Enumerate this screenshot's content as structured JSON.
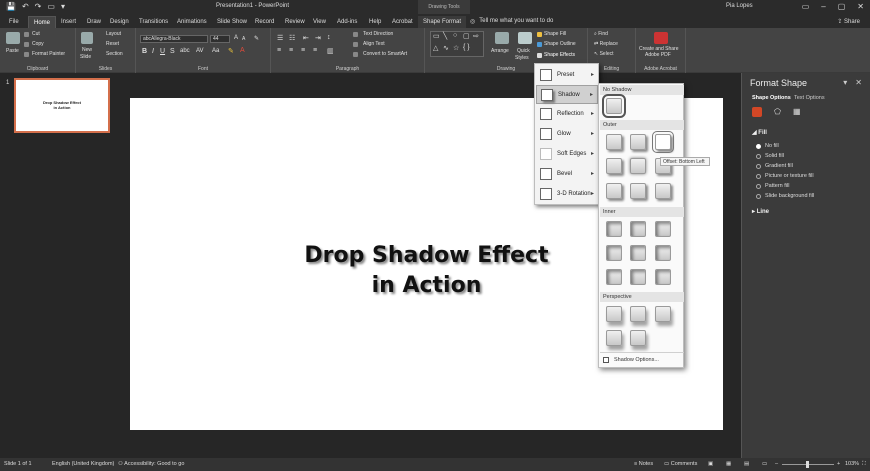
{
  "titlebar": {
    "doc_title": "Presentation1 - PowerPoint",
    "tools_tab": "Drawing Tools",
    "user": "Pia Lopes",
    "qat": [
      "💾",
      "↶",
      "↷",
      "▭",
      "▾"
    ],
    "win_ctrls": [
      "▭",
      "–",
      "▢",
      "✕"
    ]
  },
  "tabs": [
    "File",
    "Home",
    "Insert",
    "Draw",
    "Design",
    "Transitions",
    "Animations",
    "Slide Show",
    "Record",
    "Review",
    "View",
    "Add-ins",
    "Help",
    "Acrobat",
    "Shape Format"
  ],
  "tell_me": "Tell me what you want to do",
  "share_label": "Share",
  "ribbon": {
    "clipboard": {
      "label": "Clipboard",
      "paste": "Paste",
      "cut": "Cut",
      "copy": "Copy",
      "format_painter": "Format Painter"
    },
    "slides": {
      "label": "Slides",
      "new_slide": "New",
      "new_slide2": "Slide",
      "layout": "Layout",
      "reset": "Reset",
      "section": "Section"
    },
    "font": {
      "label": "Font",
      "name": "abcAllegra-Black",
      "size": "44"
    },
    "paragraph": {
      "label": "Paragraph",
      "text_direction": "Text Direction",
      "align_text": "Align Text",
      "smartart": "Convert to SmartArt"
    },
    "drawing": {
      "label": "Drawing",
      "arrange": "Arrange",
      "quick_styles": "Quick",
      "quick_styles2": "Styles",
      "shape_fill": "Shape Fill",
      "shape_outline": "Shape Outline",
      "shape_effects": "Shape Effects"
    },
    "editing": {
      "label": "Editing",
      "find": "Find",
      "replace": "Replace",
      "select": "Select"
    },
    "acrobat": {
      "label": "Adobe Acrobat",
      "create": "Create and Share",
      "create2": "Adobe PDF"
    }
  },
  "thumb": {
    "num": "1",
    "line1": "Drop Shadow Effect",
    "line2": "in Action"
  },
  "slide": {
    "line1": "Drop Shadow Effect",
    "line2": "in Action"
  },
  "effects_menu": [
    "Preset",
    "Shadow",
    "Reflection",
    "Glow",
    "Soft Edges",
    "Bevel",
    "3-D Rotation"
  ],
  "shadow_gallery": {
    "no_shadow": "No Shadow",
    "outer": "Outer",
    "inner": "Inner",
    "perspective": "Perspective",
    "options": "Shadow Options..."
  },
  "tooltip": "Offset: Bottom Left",
  "format_pane": {
    "title": "Format Shape",
    "tab_shape": "Shape Options",
    "tab_text": "Text Options",
    "fill": "Fill",
    "fill_options": [
      "No fill",
      "Solid fill",
      "Gradient fill",
      "Picture or texture fill",
      "Pattern fill",
      "Slide background fill"
    ],
    "line": "Line"
  },
  "status": {
    "slide": "Slide 1 of 1",
    "language": "English (United Kingdom)",
    "accessibility": "Accessibility: Good to go",
    "notes": "Notes",
    "comments": "Comments",
    "zoom": "103%"
  }
}
